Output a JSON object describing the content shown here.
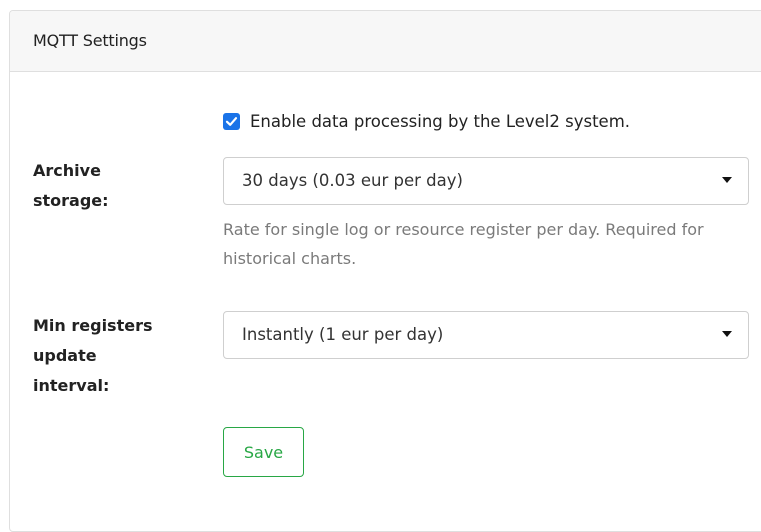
{
  "card": {
    "title": "MQTT Settings"
  },
  "enable_processing": {
    "checked": true,
    "label": "Enable data processing by the Level2 system."
  },
  "archive_storage": {
    "label_line1": "Archive",
    "label_line2": "storage:",
    "selected": "30 days (0.03 eur per day)",
    "help": "Rate for single log or resource register per day. Required for historical charts."
  },
  "update_interval": {
    "label_line1": "Min registers",
    "label_line2": "update",
    "label_line3": "interval:",
    "selected": "Instantly (1 eur per day)"
  },
  "actions": {
    "save_label": "Save"
  },
  "colors": {
    "checkbox": "#1a73e8",
    "save_button": "#28a745",
    "header_bg": "#f7f7f7",
    "help_text": "#7a7a7a"
  }
}
